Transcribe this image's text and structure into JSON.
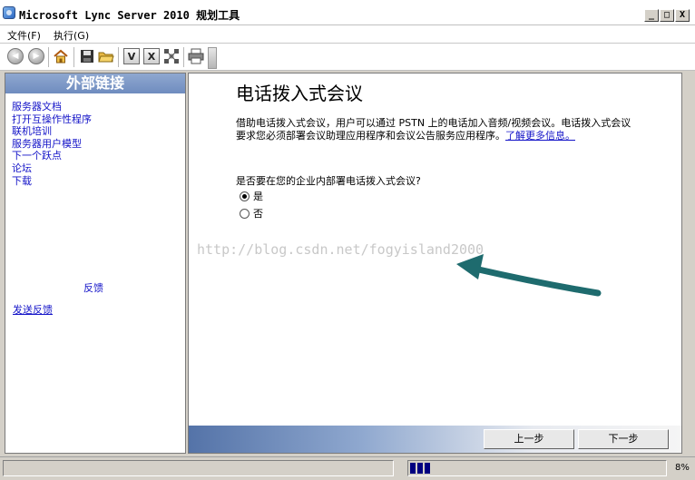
{
  "window": {
    "title": "Microsoft Lync Server 2010 规划工具",
    "minimize": "_",
    "maximize": "□",
    "close": "X"
  },
  "menu": [
    {
      "label": "文件(F)"
    },
    {
      "label": "执行(G)"
    }
  ],
  "toolbar": {
    "icons": [
      "back-icon",
      "forward-icon",
      "home-icon",
      "save-icon",
      "open-folder-icon",
      "visio-icon",
      "excel-icon",
      "topology-icon",
      "print-icon"
    ],
    "visio_glyph": "V",
    "excel_glyph": "X"
  },
  "sidebar": {
    "header": "外部链接",
    "links": [
      {
        "label": "服务器文档"
      },
      {
        "label": "打开互操作性程序"
      },
      {
        "label": "联机培训"
      },
      {
        "label": "服务器用户模型"
      },
      {
        "label": "下一个跃点"
      },
      {
        "label": "论坛"
      },
      {
        "label": "下载"
      }
    ],
    "feedback_title": "反馈",
    "feedback_link": "发送反馈"
  },
  "main": {
    "title": "电话拨入式会议",
    "description": "借助电话拨入式会议，用户可以通过 PSTN 上的电话加入音频/视频会议。电话拨入式会议要求您必须部署会议助理应用程序和会议公告服务应用程序。",
    "learn_more": "了解更多信息。",
    "question": "是否要在您的企业内部署电话拨入式会议?",
    "options": [
      {
        "label": "是",
        "selected": true
      },
      {
        "label": "否",
        "selected": false
      }
    ],
    "watermark": "http://blog.csdn.net/fogyisland2000"
  },
  "nav": {
    "prev": "上一步",
    "next": "下一步"
  },
  "status": {
    "progress_percent": 8,
    "progress_label": "8%"
  },
  "colors": {
    "link": "#1414c8",
    "header_bg": "#7a95c5",
    "arrow": "#1e6b6e",
    "progress": "#000080"
  }
}
